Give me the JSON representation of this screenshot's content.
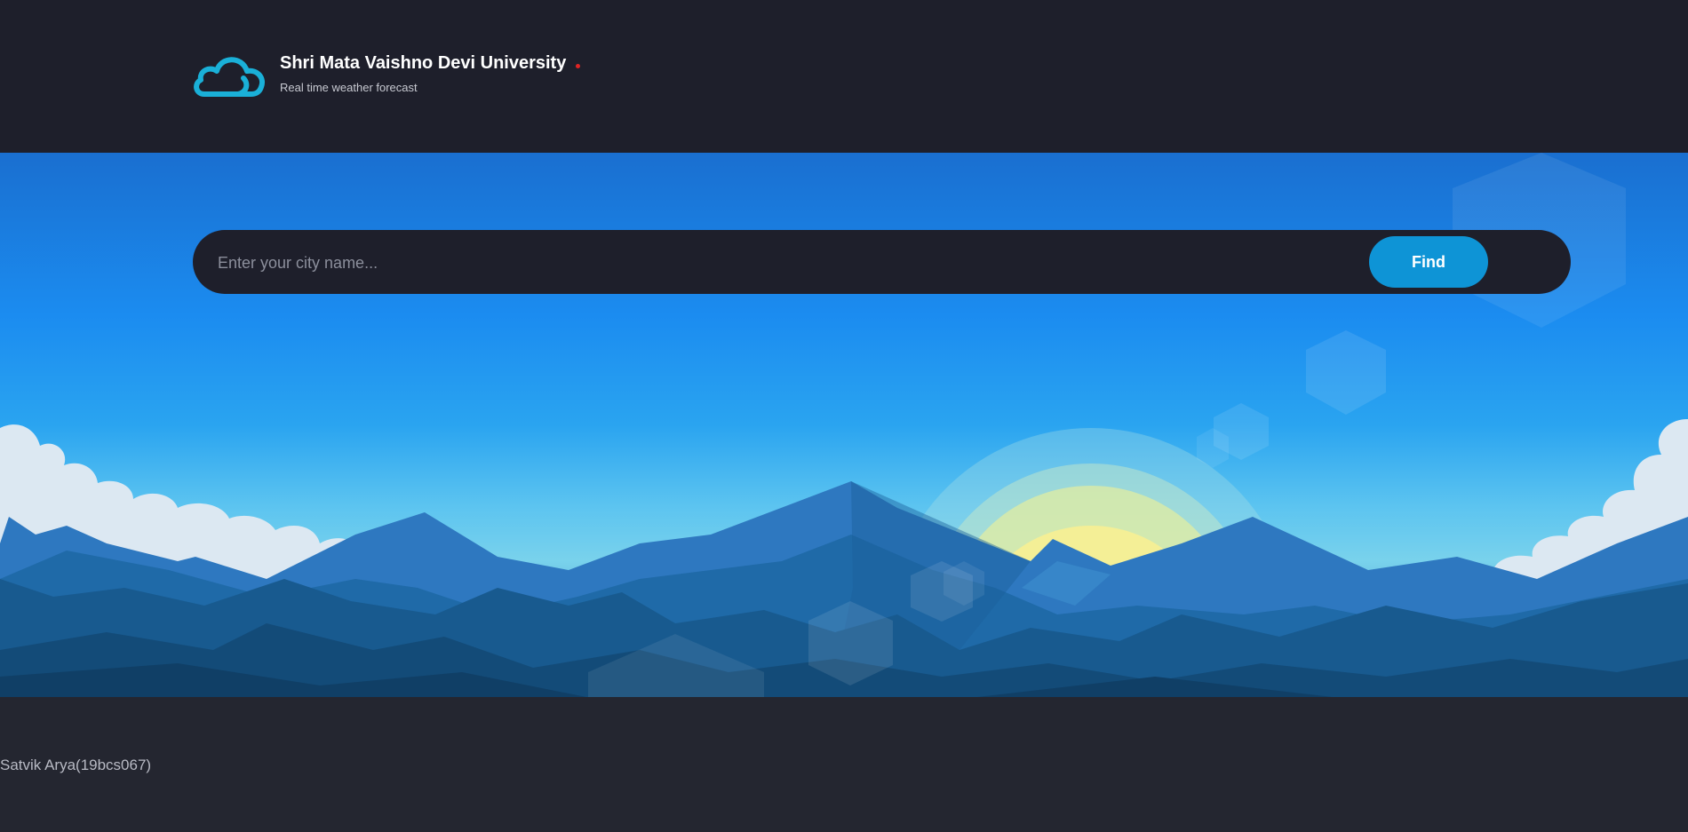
{
  "header": {
    "logo_icon": "cloud-icon",
    "title": "Shri Mata Vaishno Devi University",
    "subtitle": "Real time weather forecast"
  },
  "hero": {
    "illustration": "mountains-sunrise-illustration"
  },
  "search": {
    "placeholder": "Enter your city name...",
    "value": "",
    "button_label": "Find"
  },
  "footer": {
    "credit": "Satvik Arya(19bcs067)"
  },
  "colors": {
    "background": "#1e1f2b",
    "accent": "#0e94d6",
    "logo": "#1ab0d8",
    "indicator": "#e02424"
  }
}
